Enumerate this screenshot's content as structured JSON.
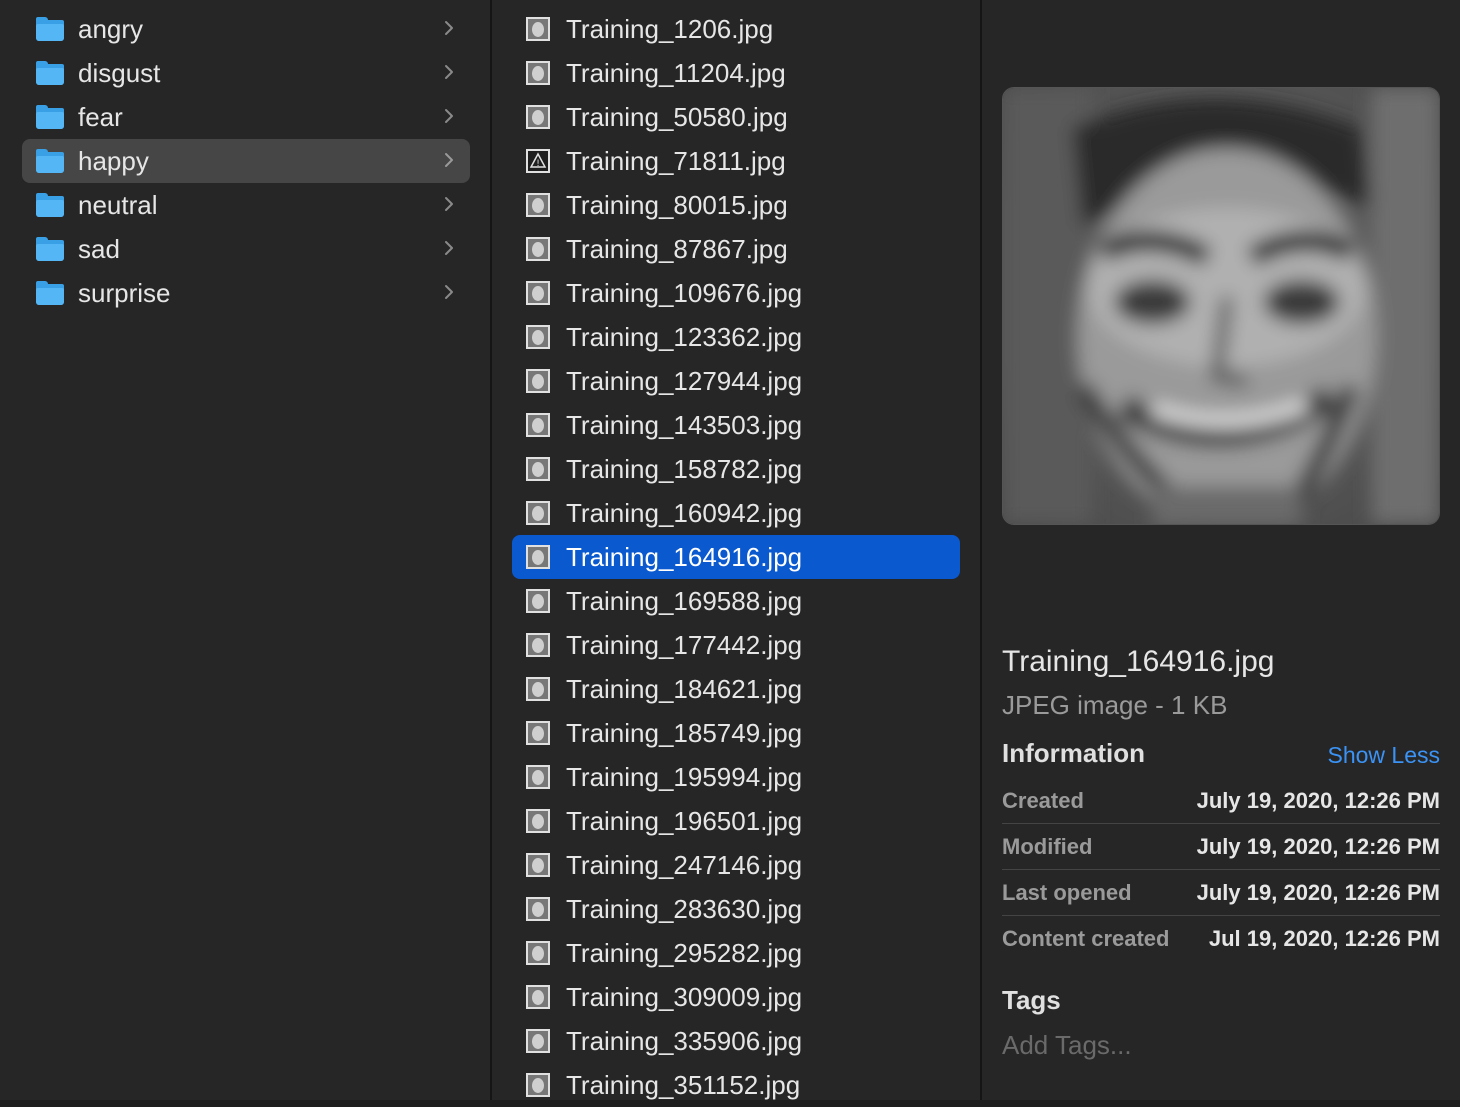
{
  "folders": [
    {
      "label": "angry",
      "selected": false
    },
    {
      "label": "disgust",
      "selected": false
    },
    {
      "label": "fear",
      "selected": false
    },
    {
      "label": "happy",
      "selected": true
    },
    {
      "label": "neutral",
      "selected": false
    },
    {
      "label": "sad",
      "selected": false
    },
    {
      "label": "surprise",
      "selected": false
    }
  ],
  "files": [
    {
      "label": "Training_1206.jpg"
    },
    {
      "label": "Training_11204.jpg"
    },
    {
      "label": "Training_50580.jpg"
    },
    {
      "label": "Training_71811.jpg"
    },
    {
      "label": "Training_80015.jpg"
    },
    {
      "label": "Training_87867.jpg"
    },
    {
      "label": "Training_109676.jpg"
    },
    {
      "label": "Training_123362.jpg"
    },
    {
      "label": "Training_127944.jpg"
    },
    {
      "label": "Training_143503.jpg"
    },
    {
      "label": "Training_158782.jpg"
    },
    {
      "label": "Training_160942.jpg"
    },
    {
      "label": "Training_164916.jpg",
      "selected": true
    },
    {
      "label": "Training_169588.jpg"
    },
    {
      "label": "Training_177442.jpg"
    },
    {
      "label": "Training_184621.jpg"
    },
    {
      "label": "Training_185749.jpg"
    },
    {
      "label": "Training_195994.jpg"
    },
    {
      "label": "Training_196501.jpg"
    },
    {
      "label": "Training_247146.jpg"
    },
    {
      "label": "Training_283630.jpg"
    },
    {
      "label": "Training_295282.jpg"
    },
    {
      "label": "Training_309009.jpg"
    },
    {
      "label": "Training_335906.jpg"
    },
    {
      "label": "Training_351152.jpg"
    }
  ],
  "preview": {
    "filename": "Training_164916.jpg",
    "kind": "JPEG image - 1 KB",
    "info_heading": "Information",
    "show_less": "Show Less",
    "info": [
      {
        "key": "Created",
        "value": "July 19, 2020, 12:26 PM"
      },
      {
        "key": "Modified",
        "value": "July 19, 2020, 12:26 PM"
      },
      {
        "key": "Last opened",
        "value": "July 19, 2020, 12:26 PM"
      },
      {
        "key": "Content created",
        "value": "Jul 19, 2020, 12:26 PM"
      }
    ],
    "tags_heading": "Tags",
    "tags_placeholder": "Add Tags..."
  },
  "colors": {
    "selection_blue": "#0a59cf",
    "folder_selected": "#464646",
    "link_blue": "#3a93f5",
    "folder_icon": "#54b6f5"
  }
}
